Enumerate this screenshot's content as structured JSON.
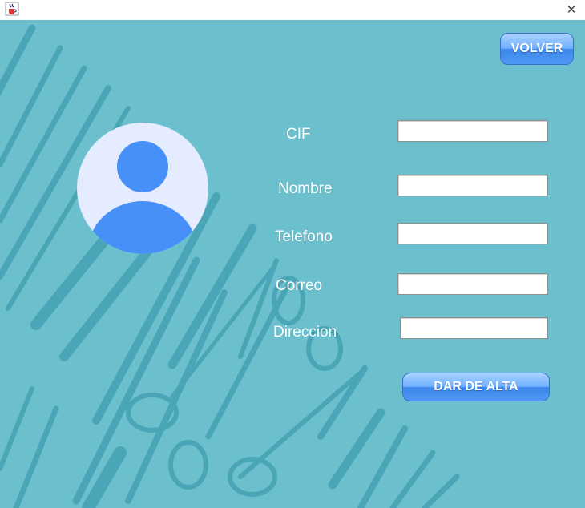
{
  "colors": {
    "background": "#6cc0cd",
    "instrument": "#4aa6b7",
    "avatar_bg": "#e6ecff",
    "avatar_figure": "#4690f7",
    "button": "#4f98f4"
  },
  "titlebar": {
    "icon": "java-cup-icon",
    "close_symbol": "✕"
  },
  "buttons": {
    "back_label": "VOLVER",
    "submit_label": "DAR DE ALTA"
  },
  "avatar": {
    "icon": "user-avatar-icon"
  },
  "form": {
    "fields": [
      {
        "label": "CIF",
        "value": ""
      },
      {
        "label": "Nombre",
        "value": ""
      },
      {
        "label": "Telefono",
        "value": ""
      },
      {
        "label": "Correo",
        "value": ""
      },
      {
        "label": "Direccion",
        "value": ""
      }
    ]
  }
}
